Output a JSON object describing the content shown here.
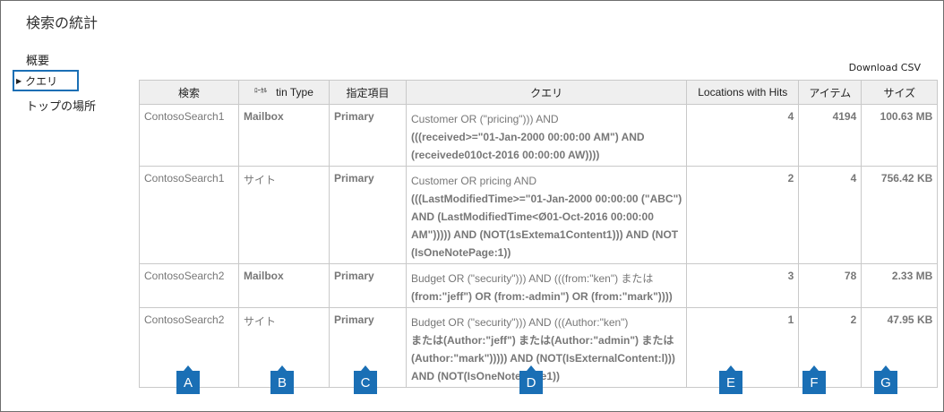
{
  "page_title": "検索の統計",
  "nav": {
    "summary": "概要",
    "query": "クエリ",
    "top_locations": "トップの場所"
  },
  "download_label": "Download CSV",
  "table": {
    "headers": {
      "search": "検索",
      "location_type_prefix": "ﾛｰｶﾙ",
      "location_type": "tin Type",
      "specified_item": "指定項目",
      "query": "クエリ",
      "locations_with_hits": "Locations with Hits",
      "items": "アイテム",
      "size": "サイズ"
    },
    "rows": [
      {
        "search": "ContosoSearch1",
        "type": "Mailbox",
        "specified": "Primary",
        "query_lines": [
          "Customer OR (\"pricing\"))) AND",
          "(((received>=\"01-Jan-2000 00:00:00 AM\") AND",
          "(receivede010ct-2016          00:00:00 AW))))"
        ],
        "hits": "4",
        "items": "4194",
        "size": "100.63 MB"
      },
      {
        "search": "ContosoSearch1",
        "type": "サイト",
        "specified": "Primary",
        "query_lines": [
          "Customer OR pricing AND",
          "(((LastModifiedTime>=\"01-Jan-2000 00:00:00 (\"ABC\")",
          "AND (LastModifiedTime<Ø01-Oct-2016          00:00:00",
          "AM\"))))) AND (NOT(1sExtema1Content1))) AND (NOT",
          "(IsOneNotePage:1))"
        ],
        "hits": "2",
        "items": "4",
        "size": "756.42 KB"
      },
      {
        "search": "ContosoSearch2",
        "type": "Mailbox",
        "specified": "Primary",
        "query_lines": [
          "Budget OR (\"security\"))) AND          (((from:\"ken\") または",
          "(from:\"jeff\") OR (from:-admin\") OR          (from:\"mark\"))))"
        ],
        "hits": "3",
        "items": "78",
        "size": "2.33 MB"
      },
      {
        "search": "ContosoSearch2",
        "type": "サイト",
        "specified": "Primary",
        "query_lines": [
          "Budget OR (\"security\"))) AND          (((Author:\"ken\")",
          "または(Author:\"jeff\") または(Author:\"admin\") または",
          "(Author:\"mark\"))))) AND (NOT(IsExternalContent:l)))",
          "AND (NOT(IsOneNotePage1))"
        ],
        "hits": "1",
        "items": "2",
        "size": "47.95 KB"
      }
    ]
  },
  "markers": [
    "A",
    "B",
    "C",
    "D",
    "E",
    "F",
    "G"
  ],
  "colors": {
    "accent": "#1a6fb5",
    "header_bg": "#efefef",
    "grid": "#c9c9c9"
  }
}
